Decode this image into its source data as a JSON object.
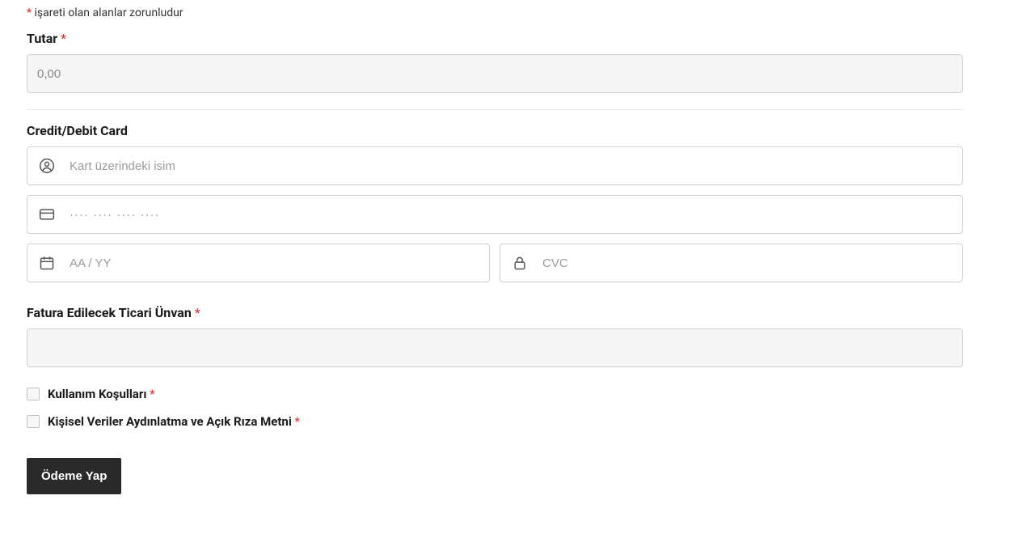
{
  "required_note_prefix": "*",
  "required_note_text": " işareti olan alanlar zorunludur",
  "amount": {
    "label": "Tutar ",
    "placeholder": "0,00",
    "value": ""
  },
  "card_section": {
    "label": "Credit/Debit Card",
    "name_placeholder": "Kart üzerindeki isim",
    "number_placeholder": "···· ···· ···· ····",
    "expiry_placeholder": "AA / YY",
    "cvc_placeholder": "CVC"
  },
  "billing": {
    "label": "Fatura Edilecek Ticari Ünvan ",
    "value": ""
  },
  "terms": {
    "label": "Kullanım Koşulları "
  },
  "privacy": {
    "label": "Kişisel Veriler Aydınlatma ve Açık Rıza Metni "
  },
  "submit_label": "Ödeme Yap",
  "required_marker": "*"
}
